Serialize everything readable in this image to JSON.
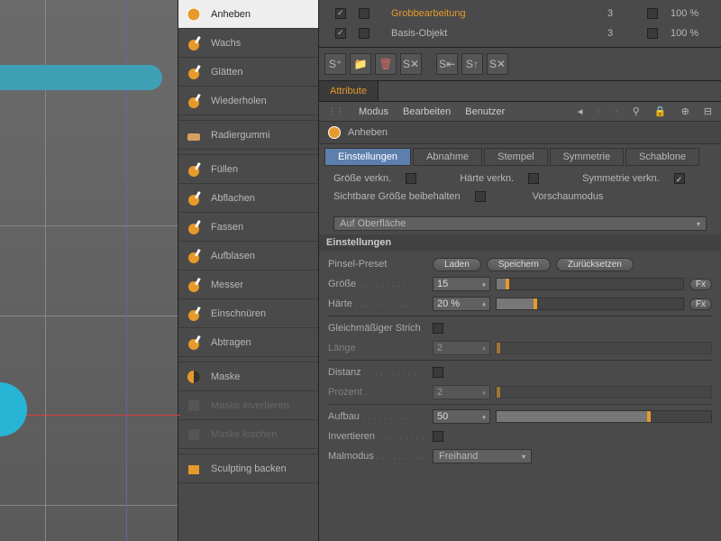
{
  "tools": {
    "items": [
      {
        "label": "Anheben",
        "icon": "sphere",
        "selected": true
      },
      {
        "label": "Wachs",
        "icon": "blob"
      },
      {
        "label": "Glätten",
        "icon": "smooth"
      },
      {
        "label": "Wiederholen",
        "icon": "cone"
      },
      {
        "sep": true
      },
      {
        "label": "Radiergummi",
        "icon": "eraser"
      },
      {
        "sep": true
      },
      {
        "label": "Füllen",
        "icon": "fill"
      },
      {
        "label": "Abflachen",
        "icon": "flatten"
      },
      {
        "label": "Fassen",
        "icon": "grab"
      },
      {
        "label": "Aufblasen",
        "icon": "inflate"
      },
      {
        "label": "Messer",
        "icon": "knife"
      },
      {
        "label": "Einschnüren",
        "icon": "pinch"
      },
      {
        "label": "Abtragen",
        "icon": "scrape"
      },
      {
        "sep": true
      },
      {
        "label": "Maske",
        "icon": "mask"
      },
      {
        "label": "Maske invertieren",
        "icon": "maskinv",
        "disabled": true
      },
      {
        "label": "Maske löschen",
        "icon": "maskdel",
        "disabled": true
      },
      {
        "sep": true
      },
      {
        "label": "Sculpting backen",
        "icon": "bake"
      }
    ]
  },
  "layers": [
    {
      "name": "Grobbearbeitung",
      "col3": "3",
      "col4": "100 %",
      "hot": true,
      "on": true
    },
    {
      "name": "Basis-Objekt",
      "col3": "3",
      "col4": "100 %",
      "on": true
    }
  ],
  "attribute_tab": "Attribute",
  "menu": {
    "modus": "Modus",
    "bearbeiten": "Bearbeiten",
    "benutzer": "Benutzer"
  },
  "object_title": "Anheben",
  "prop_tabs": [
    "Einstellungen",
    "Abnahme",
    "Stempel",
    "Symmetrie",
    "Schablone"
  ],
  "checks": {
    "groesse_verkn": "Größe verkn.",
    "haerte_verkn": "Härte verkn.",
    "symmetrie_verkn": "Symmetrie verkn.",
    "sichtbare_groesse": "Sichtbare Größe beibehalten",
    "vorschaumodus_label": "Vorschaumodus",
    "vorschaumodus_value": "Auf Oberfläche"
  },
  "section_title": "Einstellungen",
  "preset": {
    "label": "Pinsel-Preset",
    "laden": "Laden",
    "speichern": "Speichern",
    "zuruecksetzen": "Zurücksetzen"
  },
  "params": {
    "groesse_label": "Größe",
    "groesse_value": "15",
    "haerte_label": "Härte",
    "haerte_value": "20 %",
    "fx": "Fx",
    "gleichmaessig_label": "Gleichmäßiger Strich",
    "laenge_label": "Länge",
    "laenge_value": "2",
    "distanz_label": "Distanz",
    "prozent_label": "Prozent",
    "prozent_value": "2",
    "aufbau_label": "Aufbau",
    "aufbau_value": "50",
    "invertieren_label": "Invertieren",
    "malmodus_label": "Malmodus",
    "malmodus_value": "Freihand"
  }
}
